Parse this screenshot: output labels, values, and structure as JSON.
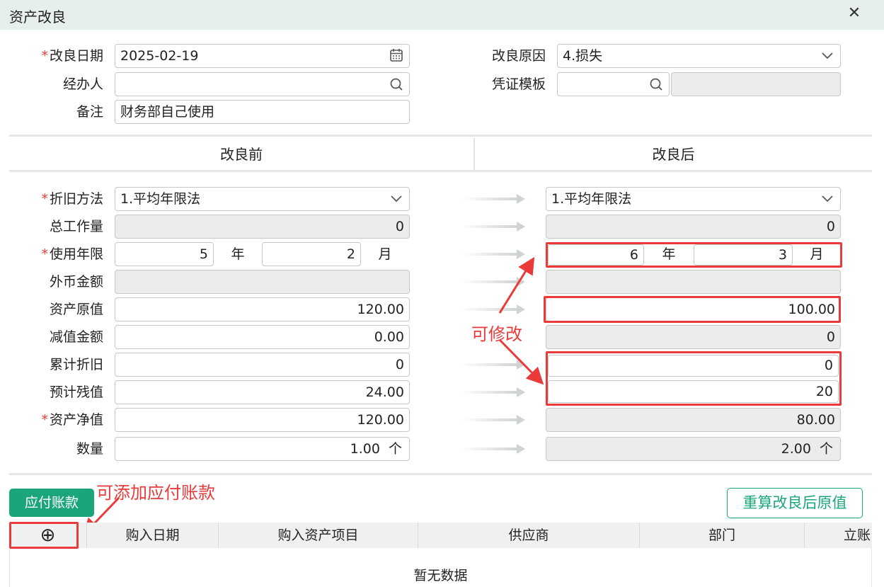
{
  "window": {
    "title": "资产改良"
  },
  "header_fields": {
    "improve_date": {
      "label": "改良日期",
      "value": "2025-02-19"
    },
    "handler": {
      "label": "经办人",
      "value": ""
    },
    "remark": {
      "label": "备注",
      "value": "财务部自己使用"
    },
    "improve_reason": {
      "label": "改良原因",
      "value": "4.损失"
    },
    "voucher_template": {
      "label": "凭证模板",
      "value": "",
      "extra": ""
    }
  },
  "columns": {
    "before": "改良前",
    "after": "改良后"
  },
  "rows": {
    "method": {
      "label": "折旧方法",
      "before": "1.平均年限法",
      "after": "1.平均年限法"
    },
    "workload": {
      "label": "总工作量",
      "before": "0",
      "after": "0"
    },
    "life": {
      "label": "使用年限",
      "before_years": "5",
      "before_months": "2",
      "after_years": "6",
      "after_months": "3",
      "year_unit": "年",
      "month_unit": "月"
    },
    "foreign": {
      "label": "外币金额",
      "before": "",
      "after": ""
    },
    "original": {
      "label": "资产原值",
      "before": "120.00",
      "after": "100.00"
    },
    "impairment": {
      "label": "减值金额",
      "before": "0.00",
      "after": "0"
    },
    "accum": {
      "label": "累计折旧",
      "before": "0",
      "after": "0"
    },
    "residual": {
      "label": "预计残值",
      "before": "24.00",
      "after": "20"
    },
    "net": {
      "label": "资产净值",
      "before": "120.00",
      "after": "80.00"
    },
    "qty": {
      "label": "数量",
      "before": "1.00",
      "after": "2.00",
      "unit": "个"
    }
  },
  "annotations": {
    "modifiable": "可修改",
    "add_payable": "可添加应付账款"
  },
  "buttons": {
    "payable": "应付账款",
    "recalc": "重算改良后原值"
  },
  "table": {
    "add_icon": "⊕",
    "headers": [
      "购入日期",
      "购入资产项目",
      "供应商",
      "部门",
      "立账"
    ],
    "empty_text": "暂无数据"
  },
  "icons": {
    "calendar": "calendar-icon",
    "search": "search-icon",
    "chevron": "chevron-down-icon",
    "close": "close-icon",
    "arrow": "right-arrow-icon"
  },
  "colors": {
    "accent": "#1ba57b",
    "required": "#e43b3b",
    "annotation": "#ea3a3a",
    "titlebar": "#e6eeee"
  }
}
